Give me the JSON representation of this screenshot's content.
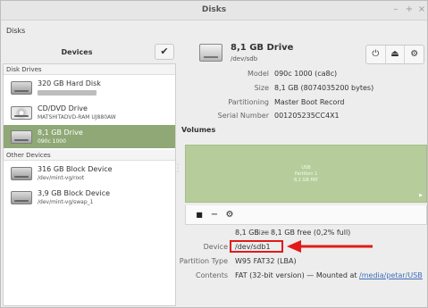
{
  "window": {
    "title": "Disks",
    "wm_buttons": [
      "–",
      "+",
      "×"
    ]
  },
  "menubar": {
    "app_name": "Disks"
  },
  "sidebar": {
    "header": "Devices",
    "sections": [
      {
        "title": "Disk Drives"
      },
      {
        "title": "Other Devices"
      }
    ],
    "devices": [
      {
        "name": "320 GB Hard Disk",
        "sub": "",
        "icon": "hard-disk-icon",
        "selected": false
      },
      {
        "name": "CD/DVD Drive",
        "sub": "MATSHITADVD-RAM UJ880AW",
        "icon": "optical-drive-icon",
        "selected": false
      },
      {
        "name": "8,1 GB Drive",
        "sub": "090c 1000",
        "icon": "usb-drive-icon",
        "selected": true
      },
      {
        "name": "316 GB Block Device",
        "sub": "/dev/mint-vg/root",
        "icon": "block-device-icon",
        "selected": false
      },
      {
        "name": "3,9 GB Block Device",
        "sub": "/dev/mint-vg/swap_1",
        "icon": "block-device-icon",
        "selected": false
      }
    ]
  },
  "drive": {
    "title": "8,1 GB Drive",
    "subtitle": "/dev/sdb",
    "tools": [
      "⏻",
      "⏏",
      "⚙"
    ],
    "properties": [
      {
        "key": "Model",
        "value": "090c 1000 (ca8c)"
      },
      {
        "key": "Size",
        "value": "8,1 GB (8074035200 bytes)"
      },
      {
        "key": "Partitioning",
        "value": "Master Boot Record"
      },
      {
        "key": "Serial Number",
        "value": "001205235CC4X1"
      }
    ]
  },
  "volumes": {
    "title": "Volumes",
    "map_lines": [
      "USB",
      "Partition 1",
      "8,1 GB FAT"
    ],
    "toolbar": [
      "■",
      "−",
      "⚙"
    ],
    "details": {
      "size": {
        "key": "Size",
        "value": "8,1 GB — 8,1 GB free (0,2% full)"
      },
      "device": {
        "key": "Device",
        "value": "/dev/sdb1"
      },
      "partition_type": {
        "key": "Partition Type",
        "value": "W95 FAT32 (LBA)"
      },
      "contents": {
        "key": "Contents",
        "value_prefix": "FAT (32-bit version) — Mounted at ",
        "link": "/media/petar/USB"
      }
    }
  },
  "colors": {
    "selected_row": "#8fa876",
    "volume_fill": "#b6cd9b",
    "annotation_red": "#e11a1a",
    "link": "#3d6fb8"
  }
}
